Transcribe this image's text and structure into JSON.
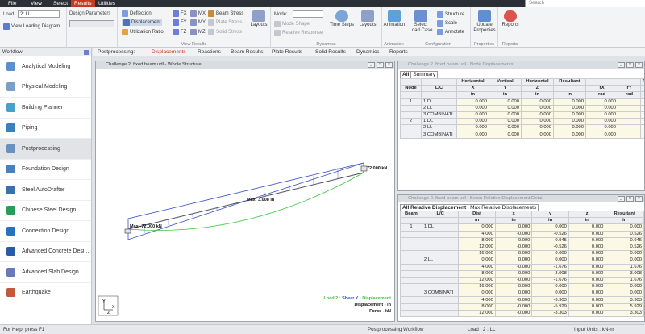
{
  "menu": [
    "File",
    "View",
    "Select",
    "Results",
    "Utilities"
  ],
  "menu_active": "Results",
  "search_placeholder": "Search",
  "ribbon": {
    "load_label": "Load:",
    "load_value": "2: LL",
    "view_loading_diagram": "View Loading Diagram",
    "design_parameters": "Design Parameters",
    "deflection": "Deflection",
    "displacement": "Displacement",
    "utilization_ratio": "Utilization Ratio",
    "fx": "FX",
    "fy": "FY",
    "fz": "FZ",
    "mx": "MX",
    "my": "MY",
    "mz": "MZ",
    "beam_stress": "Beam Stress",
    "plate_stress": "Plate Stress",
    "solid_stress": "Solid Stress",
    "layouts": "Layouts",
    "view_results": "View Results",
    "mode_label": "Mode:",
    "mode_shape": "Mode Shape",
    "relative_response": "Relative Response",
    "time_steps": "Time Steps",
    "layouts2": "Layouts",
    "dynamics": "Dynamics",
    "animation": "Animation",
    "animation_group": "Animation",
    "select_load_case": "Select Load Case",
    "structure": "Structure",
    "scale": "Scale",
    "annotate": "Annotate",
    "configuration": "Configuration",
    "update_properties": "Update Properties",
    "properties": "Properties",
    "reports": "Reports",
    "reports_group": "Reports"
  },
  "workflow": {
    "title": "Workflow",
    "items": [
      "Analytical Modeling",
      "Physical Modeling",
      "Building Planner",
      "Piping",
      "Postprocessing",
      "Foundation Design",
      "Steel AutoDrafter",
      "Chinese Steel Design",
      "Connection Design",
      "Advanced Concrete Desi...",
      "Advanced Slab Design",
      "Earthquake"
    ],
    "active": "Postprocessing"
  },
  "post_tabs": {
    "label": "Postprocessing:",
    "tabs": [
      "Displacements",
      "Reactions",
      "Beam Results",
      "Plate Results",
      "Solid Results",
      "Dynamics",
      "Reports"
    ],
    "active": "Displacements"
  },
  "structure_window": {
    "title": "Challenge 2. fixed beam udl - Whole Structure",
    "label_max_right": "72.000 kN",
    "label_max_mid": "Max: 3.008 in",
    "label_max_left": "Max:-72.000 kN",
    "legend_prefix": "Load 2 : ",
    "legend_shear": "Shear Y : ",
    "legend_disp": "Displacement",
    "legend_disp_units": "Displacement - in",
    "legend_force_units": "Force - kN",
    "axis_y": "Y",
    "axis_x": "X",
    "axis_z": "Z"
  },
  "node_window": {
    "title": "Challenge 2. fixed beam udl - Node Displacements",
    "tabs": [
      "All",
      "Summary"
    ],
    "headers": [
      "Node",
      "L/C",
      "Horizontal X in",
      "Vertical Y in",
      "Horizontal Z in",
      "Resultant in",
      "rX rad",
      "rY rad",
      "Rotat"
    ],
    "h1": [
      "",
      "",
      "Horizontal",
      "Vertical",
      "Horizontal",
      "Resultant",
      "",
      "",
      "Rotat"
    ],
    "h2": [
      "Node",
      "L/C",
      "X",
      "Y",
      "Z",
      "",
      "rX",
      "rY",
      ""
    ],
    "h3": [
      "",
      "",
      "in",
      "in",
      "in",
      "in",
      "rad",
      "rad",
      ""
    ],
    "rows": [
      [
        "1",
        "1 DL",
        "0.000",
        "0.000",
        "0.000",
        "0.000",
        "0.000",
        "",
        ""
      ],
      [
        "",
        "2 LL",
        "0.000",
        "0.000",
        "0.000",
        "0.000",
        "0.000",
        "",
        ""
      ],
      [
        "",
        "3 COMBINATI",
        "0.000",
        "0.000",
        "0.000",
        "0.000",
        "0.000",
        "",
        ""
      ],
      [
        "2",
        "1 DL",
        "0.000",
        "0.000",
        "0.000",
        "0.000",
        "0.000",
        "",
        ""
      ],
      [
        "",
        "2 LL",
        "0.000",
        "0.000",
        "0.000",
        "0.000",
        "0.000",
        "",
        ""
      ],
      [
        "",
        "3 COMBINATI",
        "0.000",
        "0.000",
        "0.000",
        "0.000",
        "0.000",
        "",
        ""
      ]
    ]
  },
  "beam_window": {
    "title": "Challenge 2. fixed beam udl - Beam Relative Displacement Detail",
    "tabs": [
      "All Relative Displacement",
      "Max Relative Displacements"
    ],
    "h1": [
      "Beam",
      "L/C",
      "Dist",
      "x",
      "y",
      "z",
      "Resultant"
    ],
    "h2": [
      "",
      "",
      "m",
      "in",
      "in",
      "in",
      "in"
    ],
    "rows": [
      [
        "1",
        "1 DL",
        "0.000",
        "0.000",
        "0.000",
        "0.000",
        "0.000"
      ],
      [
        "",
        "",
        "4.000",
        "-0.000",
        "-0.526",
        "0.000",
        "0.526"
      ],
      [
        "",
        "",
        "8.000",
        "-0.000",
        "-0.945",
        "0.000",
        "0.945"
      ],
      [
        "",
        "",
        "12.000",
        "-0.000",
        "-0.526",
        "0.000",
        "0.526"
      ],
      [
        "",
        "",
        "16.000",
        "0.000",
        "0.000",
        "0.000",
        "0.000"
      ],
      [
        "",
        "2 LL",
        "0.000",
        "0.000",
        "0.000",
        "0.000",
        "0.000"
      ],
      [
        "",
        "",
        "4.000",
        "-0.000",
        "-1.676",
        "0.000",
        "1.676"
      ],
      [
        "",
        "",
        "8.000",
        "-0.000",
        "-3.008",
        "0.000",
        "3.008"
      ],
      [
        "",
        "",
        "12.000",
        "-0.000",
        "-1.676",
        "0.000",
        "1.676"
      ],
      [
        "",
        "",
        "16.000",
        "0.000",
        "0.000",
        "0.000",
        "0.000"
      ],
      [
        "",
        "3 COMBINATI",
        "0.000",
        "0.000",
        "0.000",
        "0.000",
        "0.000"
      ],
      [
        "",
        "",
        "4.000",
        "-0.000",
        "-3.303",
        "0.000",
        "3.303"
      ],
      [
        "",
        "",
        "8.000",
        "-0.000",
        "-5.929",
        "0.000",
        "5.929"
      ],
      [
        "",
        "",
        "12.000",
        "-0.000",
        "-3.303",
        "0.000",
        "3.303"
      ]
    ]
  },
  "status": {
    "help": "For Help, press F1",
    "workflow": "Postprocessing Workflow",
    "load": "Load : 2 : LL",
    "units": "Input Units : kN-m"
  },
  "colors": {
    "accent": "#c23b22",
    "shear": "#3b52c8",
    "displacement": "#3cc23c",
    "beam": "#4a5060"
  }
}
